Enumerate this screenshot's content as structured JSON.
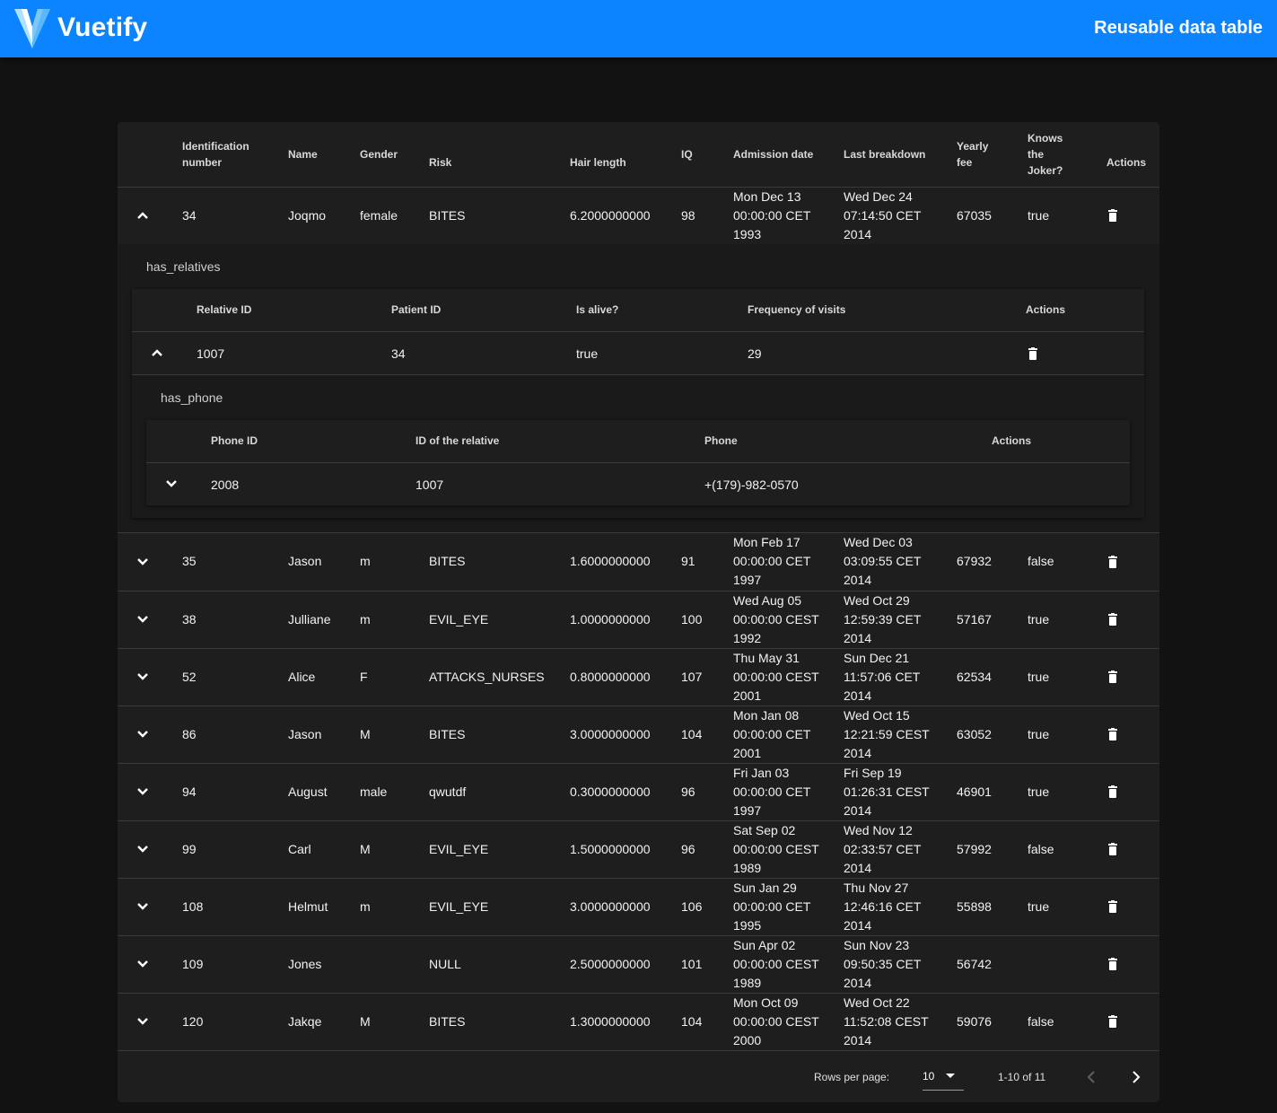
{
  "app": {
    "brand": "Vuetify",
    "title": "Reusable data table"
  },
  "main_table": {
    "headers": [
      "Identification number",
      "Name",
      "Gender",
      "Risk",
      "Hair length",
      "IQ",
      "Admission date",
      "Last breakdown",
      "Yearly fee",
      "Knows the Joker?",
      "Actions"
    ],
    "rows": [
      {
        "id": "34",
        "name": "Joqmo",
        "gender": "female",
        "risk": "BITES",
        "hair": "6.2000000000",
        "iq": "98",
        "admission": "Mon Dec 13 00:00:00 CET 1993",
        "breakdown": "Wed Dec 24 07:14:50 CET 2014",
        "fee": "67035",
        "joker": "true",
        "expanded": true
      },
      {
        "id": "35",
        "name": "Jason",
        "gender": "m",
        "risk": "BITES",
        "hair": "1.6000000000",
        "iq": "91",
        "admission": "Mon Feb 17 00:00:00 CET 1997",
        "breakdown": "Wed Dec 03 03:09:55 CET 2014",
        "fee": "67932",
        "joker": "false",
        "expanded": false
      },
      {
        "id": "38",
        "name": "Julliane",
        "gender": "m",
        "risk": "EVIL_EYE",
        "hair": "1.0000000000",
        "iq": "100",
        "admission": "Wed Aug 05 00:00:00 CEST 1992",
        "breakdown": "Wed Oct 29 12:59:39 CET 2014",
        "fee": "57167",
        "joker": "true",
        "expanded": false
      },
      {
        "id": "52",
        "name": "Alice",
        "gender": "F",
        "risk": "ATTACKS_NURSES",
        "hair": "0.8000000000",
        "iq": "107",
        "admission": "Thu May 31 00:00:00 CEST 2001",
        "breakdown": "Sun Dec 21 11:57:06 CET 2014",
        "fee": "62534",
        "joker": "true",
        "expanded": false
      },
      {
        "id": "86",
        "name": "Jason",
        "gender": "M",
        "risk": "BITES",
        "hair": "3.0000000000",
        "iq": "104",
        "admission": "Mon Jan 08 00:00:00 CET 2001",
        "breakdown": "Wed Oct 15 12:21:59 CEST 2014",
        "fee": "63052",
        "joker": "true",
        "expanded": false
      },
      {
        "id": "94",
        "name": "August",
        "gender": "male",
        "risk": "qwutdf",
        "hair": "0.3000000000",
        "iq": "96",
        "admission": "Fri Jan 03 00:00:00 CET 1997",
        "breakdown": "Fri Sep 19 01:26:31 CEST 2014",
        "fee": "46901",
        "joker": "true",
        "expanded": false
      },
      {
        "id": "99",
        "name": "Carl",
        "gender": "M",
        "risk": "EVIL_EYE",
        "hair": "1.5000000000",
        "iq": "96",
        "admission": "Sat Sep 02 00:00:00 CEST 1989",
        "breakdown": "Wed Nov 12 02:33:57 CET 2014",
        "fee": "57992",
        "joker": "false",
        "expanded": false
      },
      {
        "id": "108",
        "name": "Helmut",
        "gender": "m",
        "risk": "EVIL_EYE",
        "hair": "3.0000000000",
        "iq": "106",
        "admission": "Sun Jan 29 00:00:00 CET 1995",
        "breakdown": "Thu Nov 27 12:46:16 CET 2014",
        "fee": "55898",
        "joker": "true",
        "expanded": false
      },
      {
        "id": "109",
        "name": "Jones",
        "gender": "",
        "risk": "NULL",
        "hair": "2.5000000000",
        "iq": "101",
        "admission": "Sun Apr 02 00:00:00 CEST 1989",
        "breakdown": "Sun Nov 23 09:50:35 CET 2014",
        "fee": "56742",
        "joker": "",
        "expanded": false
      },
      {
        "id": "120",
        "name": "Jakqe",
        "gender": "M",
        "risk": "BITES",
        "hair": "1.3000000000",
        "iq": "104",
        "admission": "Mon Oct 09 00:00:00 CEST 2000",
        "breakdown": "Wed Oct 22 11:52:08 CEST 2014",
        "fee": "59076",
        "joker": "false",
        "expanded": false
      }
    ]
  },
  "relatives": {
    "title": "has_relatives",
    "headers": [
      "Relative ID",
      "Patient ID",
      "Is alive?",
      "Frequency of visits",
      "Actions"
    ],
    "row": {
      "relative_id": "1007",
      "patient_id": "34",
      "alive": "true",
      "frequency": "29"
    }
  },
  "phones": {
    "title": "has_phone",
    "headers": [
      "Phone ID",
      "ID of the relative",
      "Phone",
      "Actions"
    ],
    "row": {
      "phone_id": "2008",
      "relative_id": "1007",
      "phone": "+(179)-982-0570"
    }
  },
  "footer": {
    "rows_per_page_label": "Rows per page:",
    "rows_per_page": "10",
    "range": "1-10 of 11"
  },
  "colors": {
    "appbar": "#0d84ff",
    "background": "#121212",
    "card": "#1e1e1e"
  }
}
